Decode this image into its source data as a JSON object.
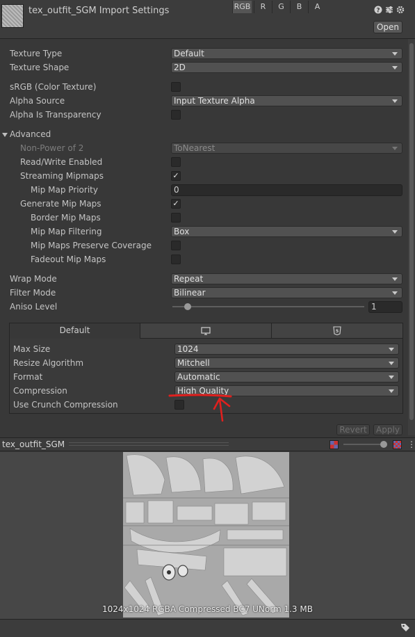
{
  "header": {
    "title": "tex_outfit_SGM Import Settings",
    "open_label": "Open",
    "icons": [
      "help-icon",
      "preset-icon",
      "gear-icon"
    ]
  },
  "rows": {
    "texture_type": {
      "label": "Texture Type",
      "value": "Default"
    },
    "texture_shape": {
      "label": "Texture Shape",
      "value": "2D"
    },
    "srgb": {
      "label": "sRGB (Color Texture)",
      "checked": false
    },
    "alpha_source": {
      "label": "Alpha Source",
      "value": "Input Texture Alpha"
    },
    "alpha_transparency": {
      "label": "Alpha Is Transparency",
      "checked": false
    },
    "advanced": {
      "label": "Advanced"
    },
    "non_power": {
      "label": "Non-Power of 2",
      "value": "ToNearest"
    },
    "read_write": {
      "label": "Read/Write Enabled",
      "checked": false
    },
    "streaming_mipmaps": {
      "label": "Streaming Mipmaps",
      "checked": true,
      "check_glyph": "✓"
    },
    "mip_priority": {
      "label": "Mip Map Priority",
      "value": "0"
    },
    "generate_mips": {
      "label": "Generate Mip Maps",
      "checked": true,
      "check_glyph": "✓"
    },
    "border_mips": {
      "label": "Border Mip Maps",
      "checked": false
    },
    "mip_filtering": {
      "label": "Mip Map Filtering",
      "value": "Box"
    },
    "preserve_coverage": {
      "label": "Mip Maps Preserve Coverage",
      "checked": false
    },
    "fadeout": {
      "label": "Fadeout Mip Maps",
      "checked": false
    },
    "wrap_mode": {
      "label": "Wrap Mode",
      "value": "Repeat"
    },
    "filter_mode": {
      "label": "Filter Mode",
      "value": "Bilinear"
    },
    "aniso": {
      "label": "Aniso Level",
      "value": "1",
      "slider_fraction": 0.08
    }
  },
  "platform": {
    "tabs": [
      {
        "label": "Default"
      },
      {
        "icon": "monitor-icon"
      },
      {
        "icon": "html5-icon"
      }
    ],
    "max_size": {
      "label": "Max Size",
      "value": "1024"
    },
    "resize": {
      "label": "Resize Algorithm",
      "value": "Mitchell"
    },
    "format": {
      "label": "Format",
      "value": "Automatic"
    },
    "compression": {
      "label": "Compression",
      "value": "High Quality"
    },
    "crunch": {
      "label": "Use Crunch Compression",
      "checked": false
    }
  },
  "actions": {
    "revert": "Revert",
    "apply": "Apply"
  },
  "preview": {
    "name": "tex_outfit_SGM",
    "channels": [
      "RGB",
      "R",
      "G",
      "B",
      "A"
    ],
    "info": "1024x1024  RGBA Compressed BC7 UNorm   1.3 MB",
    "mip_fraction": 0.97
  },
  "annotation_color": "#e0201e"
}
